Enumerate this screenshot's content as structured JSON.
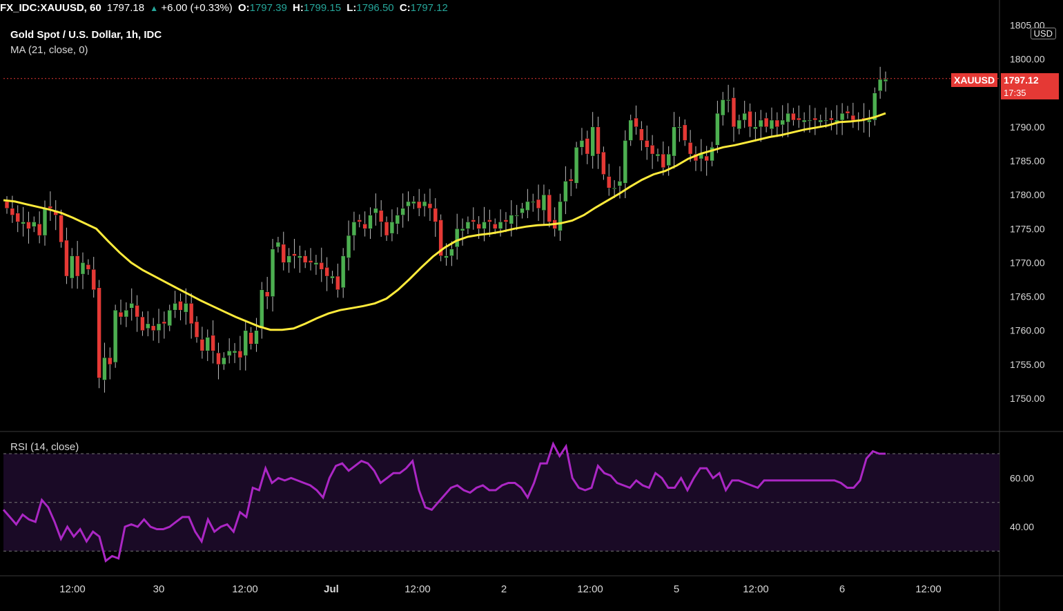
{
  "topbar": {
    "symbol": "FX_IDC:XAUUSD, 60",
    "last": "1797.18",
    "change": "+6.00 (+0.33%)",
    "o_label": "O:",
    "o_value": "1797.39",
    "h_label": "H:",
    "h_value": "1799.15",
    "l_label": "L:",
    "l_value": "1796.50",
    "c_label": "C:",
    "c_value": "1797.12"
  },
  "legend": {
    "title": "Gold Spot / U.S. Dollar, 1h, IDC",
    "ma": "MA (21, close, 0)",
    "rsi": "RSI (14, close)"
  },
  "currency_button": "USD",
  "price_tag": {
    "symbol": "XAUUSD",
    "price": "1797.12",
    "countdown": "17:35"
  },
  "colors": {
    "up": "#26a69a",
    "up_fill": "#4caf50",
    "down": "#e53935",
    "ma": "#ffeb3b",
    "rsi": "#ab27c4",
    "rsi_band": "#1a0a26"
  },
  "chart_data": [
    {
      "type": "candlestick",
      "title": "Gold Spot / U.S. Dollar, 1h, IDC",
      "x_ticks": [
        "12:00",
        "30",
        "12:00",
        "Jul",
        "12:00",
        "2",
        "12:00",
        "5",
        "12:00",
        "6",
        "12:00"
      ],
      "y_ticks": [
        1750,
        1755,
        1760,
        1765,
        1770,
        1775,
        1780,
        1785,
        1790,
        1795,
        1800,
        1805
      ],
      "y_tick_labels": [
        "1750.00",
        "1755.00",
        "1760.00",
        "1765.00",
        "1770.00",
        "1775.00",
        "1780.00",
        "1785.00",
        "1790.00",
        "1795.00",
        "1800.00",
        "1805.00"
      ],
      "ylim": [
        1746,
        1810
      ],
      "close": [
        1778,
        1777,
        1776,
        1776,
        1775,
        1776,
        1774,
        1778,
        1778,
        1777,
        1773,
        1768,
        1771,
        1768,
        1770,
        1769,
        1766,
        1753,
        1756,
        1755,
        1763,
        1762,
        1763,
        1764,
        1762,
        1760,
        1761,
        1760,
        1761,
        1761,
        1763,
        1764,
        1763,
        1764,
        1761,
        1759,
        1757,
        1759,
        1757,
        1755,
        1756,
        1757,
        1757,
        1756,
        1760,
        1758,
        1760,
        1766,
        1765,
        1772,
        1773,
        1770,
        1771,
        1771,
        1771,
        1770,
        1770,
        1770,
        1769,
        1768,
        1768,
        1766,
        1771,
        1774,
        1776,
        1776,
        1775,
        1777,
        1778,
        1776,
        1774,
        1776,
        1777,
        1778,
        1779,
        1779,
        1778,
        1779,
        1778,
        1776,
        1771,
        1771,
        1772,
        1775,
        1775,
        1776,
        1776,
        1775,
        1776,
        1776,
        1775,
        1776,
        1776,
        1777,
        1777,
        1778,
        1779,
        1779,
        1778,
        1780,
        1776,
        1775,
        1779,
        1782,
        1782,
        1787,
        1788,
        1786,
        1790,
        1786,
        1783,
        1781,
        1781,
        1782,
        1788,
        1791,
        1790,
        1788,
        1787,
        1786,
        1786,
        1784,
        1786,
        1790,
        1790,
        1788,
        1786,
        1785,
        1786,
        1785,
        1787,
        1792,
        1794,
        1794,
        1790,
        1791,
        1792,
        1790,
        1790,
        1791,
        1790,
        1791,
        1790,
        1791,
        1792,
        1791,
        1791,
        1791,
        1791,
        1791,
        1791,
        1791,
        1791,
        1791,
        1792,
        1792,
        1791,
        1791,
        1791,
        1791,
        1795,
        1797,
        1797
      ],
      "series": [
        {
          "name": "MA (21, close, 0)",
          "values": [
            1779.2,
            1779.0,
            1778.6,
            1778.2,
            1777.8,
            1777.3,
            1776.6,
            1775.8,
            1775.0,
            1773.2,
            1771.5,
            1770.0,
            1768.9,
            1768.0,
            1767.1,
            1766.2,
            1765.3,
            1764.4,
            1763.6,
            1762.8,
            1762.0,
            1761.3,
            1760.6,
            1760.1,
            1760.1,
            1760.3,
            1761.0,
            1761.8,
            1762.5,
            1763.0,
            1763.3,
            1763.6,
            1764.0,
            1764.7,
            1766.0,
            1767.6,
            1769.3,
            1770.9,
            1772.2,
            1773.2,
            1773.8,
            1774.1,
            1774.3,
            1774.6,
            1775.0,
            1775.3,
            1775.5,
            1775.6,
            1775.8,
            1776.2,
            1777.0,
            1778.1,
            1779.1,
            1780.1,
            1781.2,
            1782.2,
            1783.0,
            1783.5,
            1784.3,
            1785.3,
            1786.0,
            1786.5,
            1787.0,
            1787.3,
            1787.7,
            1788.1,
            1788.5,
            1788.8,
            1789.2,
            1789.6,
            1789.9,
            1790.2,
            1790.7,
            1790.8,
            1791.0,
            1791.4,
            1792.0
          ]
        },
        {
          "name": "RSI (14, close)",
          "values": [
            47,
            44,
            41,
            45,
            43,
            42,
            51,
            48,
            42,
            35,
            40,
            36,
            39,
            34,
            38,
            36,
            26,
            28,
            27,
            40,
            41,
            40,
            43,
            40,
            39,
            39,
            40,
            42,
            44,
            44,
            38,
            34,
            43,
            38,
            40,
            41,
            38,
            46,
            44,
            56,
            55,
            64,
            58,
            60,
            59,
            60,
            59,
            58,
            57,
            55,
            52,
            60,
            65,
            66,
            63,
            65,
            67,
            66,
            63,
            58,
            60,
            62,
            62,
            64,
            67,
            55,
            48,
            47,
            50,
            53,
            56,
            57,
            55,
            54,
            56,
            57,
            55,
            55,
            57,
            58,
            58,
            56,
            52,
            58,
            66,
            66,
            74,
            69,
            73,
            60,
            56,
            55,
            56,
            65,
            62,
            61,
            58,
            57,
            56,
            59,
            57,
            56,
            62,
            60,
            56,
            56,
            60,
            55,
            60,
            64,
            64,
            60,
            62,
            55,
            59,
            59,
            58,
            57,
            56,
            59,
            59,
            59,
            59,
            59,
            59,
            59,
            59,
            59,
            59,
            59,
            59,
            58,
            56,
            56,
            59,
            68,
            71,
            70,
            70
          ]
        }
      ],
      "rsi_y_tick_labels": [
        "40.00",
        "60.00"
      ],
      "rsi_levels": [
        30,
        50,
        70
      ],
      "rsi_ylim": [
        21,
        80
      ],
      "grid": false
    }
  ]
}
